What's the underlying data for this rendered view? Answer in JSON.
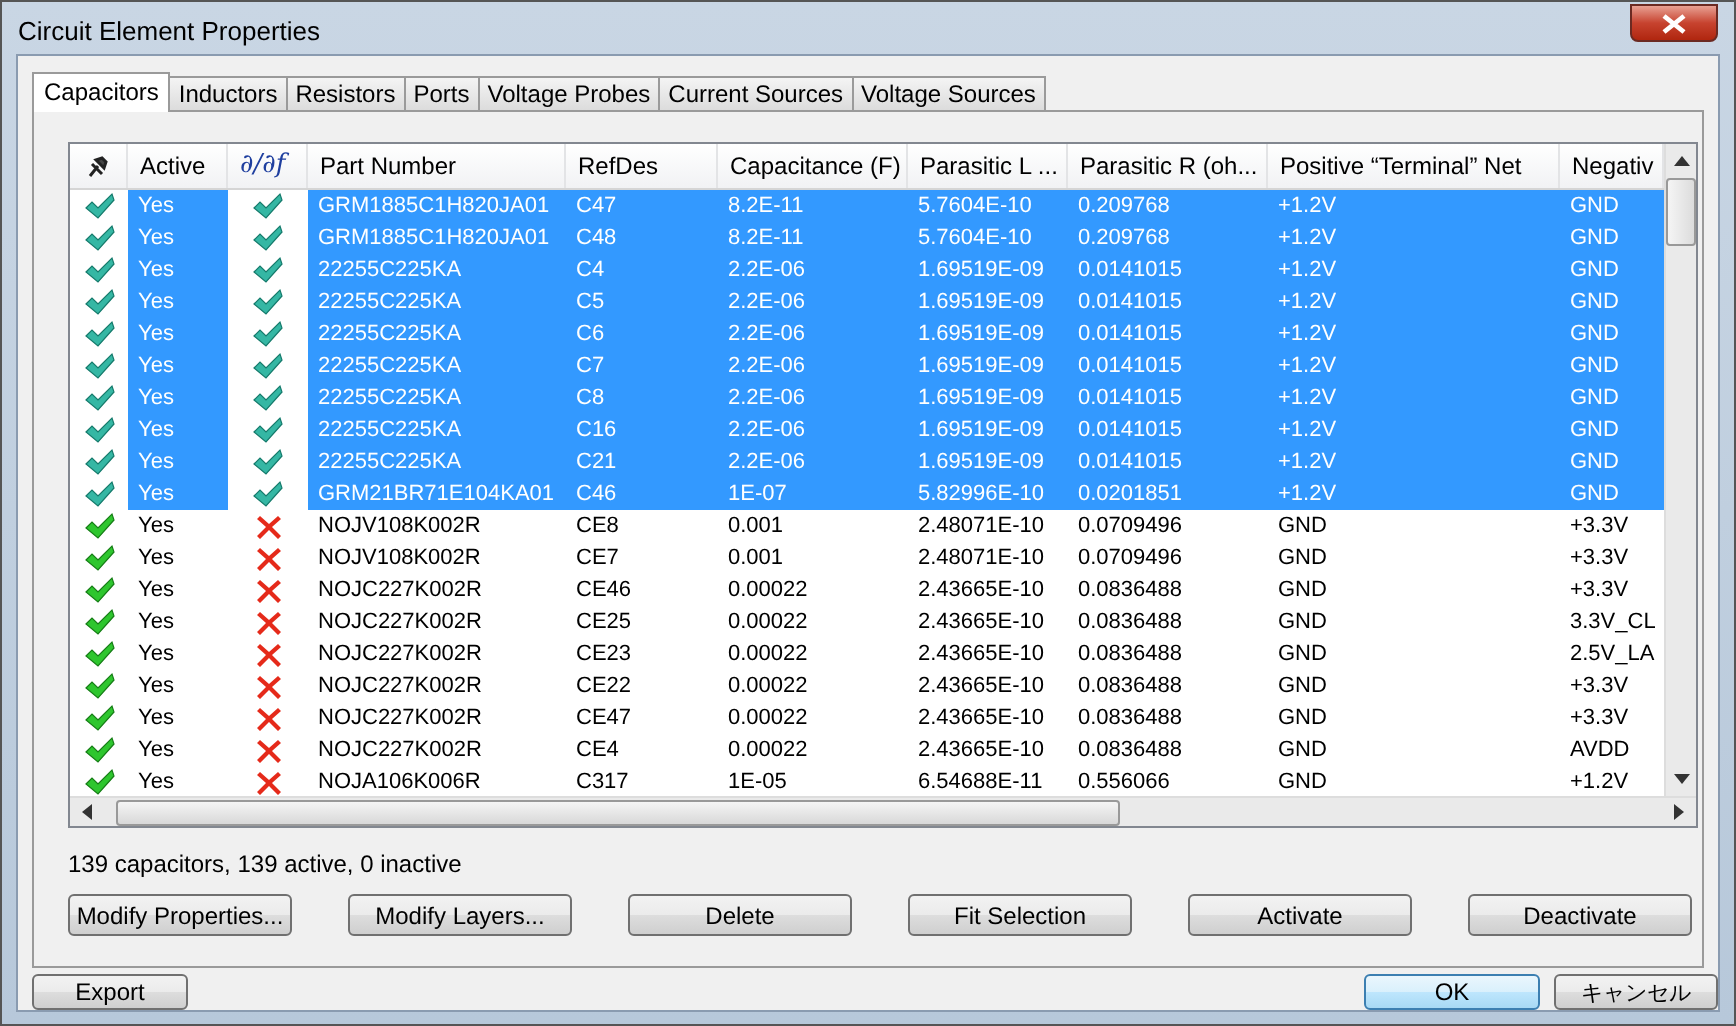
{
  "window": {
    "title": "Circuit Element Properties"
  },
  "tabs": [
    {
      "label": "Capacitors",
      "selected": true
    },
    {
      "label": "Inductors",
      "selected": false
    },
    {
      "label": "Resistors",
      "selected": false
    },
    {
      "label": "Ports",
      "selected": false
    },
    {
      "label": "Voltage Probes",
      "selected": false
    },
    {
      "label": "Current Sources",
      "selected": false
    },
    {
      "label": "Voltage Sources",
      "selected": false
    }
  ],
  "table": {
    "columns": [
      "Active",
      "∂/∂f",
      "Part Number",
      "RefDes",
      "Capacitance (F)",
      "Parasitic L ...",
      "Parasitic R (oh...",
      "Positive “Terminal” Net",
      "Negativ"
    ],
    "rows": [
      {
        "selected": true,
        "enabled": true,
        "active": "Yes",
        "frequency_dependent": true,
        "part_number": "GRM1885C1H820JA01",
        "refdes": "C47",
        "capacitance": "8.2E-11",
        "parasitic_l": "5.7604E-10",
        "parasitic_r": "0.209768",
        "positive_net": "+1.2V",
        "column_9": "GND"
      },
      {
        "selected": true,
        "enabled": true,
        "active": "Yes",
        "frequency_dependent": true,
        "part_number": "GRM1885C1H820JA01",
        "refdes": "C48",
        "capacitance": "8.2E-11",
        "parasitic_l": "5.7604E-10",
        "parasitic_r": "0.209768",
        "positive_net": "+1.2V",
        "column_9": "GND"
      },
      {
        "selected": true,
        "enabled": true,
        "active": "Yes",
        "frequency_dependent": true,
        "part_number": "22255C225KA",
        "refdes": "C4",
        "capacitance": "2.2E-06",
        "parasitic_l": "1.69519E-09",
        "parasitic_r": "0.0141015",
        "positive_net": "+1.2V",
        "column_9": "GND"
      },
      {
        "selected": true,
        "enabled": true,
        "active": "Yes",
        "frequency_dependent": true,
        "part_number": "22255C225KA",
        "refdes": "C5",
        "capacitance": "2.2E-06",
        "parasitic_l": "1.69519E-09",
        "parasitic_r": "0.0141015",
        "positive_net": "+1.2V",
        "column_9": "GND"
      },
      {
        "selected": true,
        "enabled": true,
        "active": "Yes",
        "frequency_dependent": true,
        "part_number": "22255C225KA",
        "refdes": "C6",
        "capacitance": "2.2E-06",
        "parasitic_l": "1.69519E-09",
        "parasitic_r": "0.0141015",
        "positive_net": "+1.2V",
        "column_9": "GND"
      },
      {
        "selected": true,
        "enabled": true,
        "active": "Yes",
        "frequency_dependent": true,
        "part_number": "22255C225KA",
        "refdes": "C7",
        "capacitance": "2.2E-06",
        "parasitic_l": "1.69519E-09",
        "parasitic_r": "0.0141015",
        "positive_net": "+1.2V",
        "column_9": "GND"
      },
      {
        "selected": true,
        "enabled": true,
        "active": "Yes",
        "frequency_dependent": true,
        "part_number": "22255C225KA",
        "refdes": "C8",
        "capacitance": "2.2E-06",
        "parasitic_l": "1.69519E-09",
        "parasitic_r": "0.0141015",
        "positive_net": "+1.2V",
        "column_9": "GND"
      },
      {
        "selected": true,
        "enabled": true,
        "active": "Yes",
        "frequency_dependent": true,
        "part_number": "22255C225KA",
        "refdes": "C16",
        "capacitance": "2.2E-06",
        "parasitic_l": "1.69519E-09",
        "parasitic_r": "0.0141015",
        "positive_net": "+1.2V",
        "column_9": "GND"
      },
      {
        "selected": true,
        "enabled": true,
        "active": "Yes",
        "frequency_dependent": true,
        "part_number": "22255C225KA",
        "refdes": "C21",
        "capacitance": "2.2E-06",
        "parasitic_l": "1.69519E-09",
        "parasitic_r": "0.0141015",
        "positive_net": "+1.2V",
        "column_9": "GND"
      },
      {
        "selected": true,
        "enabled": true,
        "active": "Yes",
        "frequency_dependent": true,
        "part_number": "GRM21BR71E104KA01",
        "refdes": "C46",
        "capacitance": "1E-07",
        "parasitic_l": "5.82996E-10",
        "parasitic_r": "0.0201851",
        "positive_net": "+1.2V",
        "column_9": "GND"
      },
      {
        "selected": false,
        "enabled": true,
        "active": "Yes",
        "frequency_dependent": false,
        "part_number": "NOJV108K002R",
        "refdes": "CE8",
        "capacitance": "0.001",
        "parasitic_l": "2.48071E-10",
        "parasitic_r": "0.0709496",
        "positive_net": "GND",
        "column_9": "+3.3V"
      },
      {
        "selected": false,
        "enabled": true,
        "active": "Yes",
        "frequency_dependent": false,
        "part_number": "NOJV108K002R",
        "refdes": "CE7",
        "capacitance": "0.001",
        "parasitic_l": "2.48071E-10",
        "parasitic_r": "0.0709496",
        "positive_net": "GND",
        "column_9": "+3.3V"
      },
      {
        "selected": false,
        "enabled": true,
        "active": "Yes",
        "frequency_dependent": false,
        "part_number": "NOJC227K002R",
        "refdes": "CE46",
        "capacitance": "0.00022",
        "parasitic_l": "2.43665E-10",
        "parasitic_r": "0.0836488",
        "positive_net": "GND",
        "column_9": "+3.3V"
      },
      {
        "selected": false,
        "enabled": true,
        "active": "Yes",
        "frequency_dependent": false,
        "part_number": "NOJC227K002R",
        "refdes": "CE25",
        "capacitance": "0.00022",
        "parasitic_l": "2.43665E-10",
        "parasitic_r": "0.0836488",
        "positive_net": "GND",
        "column_9": "3.3V_CL"
      },
      {
        "selected": false,
        "enabled": true,
        "active": "Yes",
        "frequency_dependent": false,
        "part_number": "NOJC227K002R",
        "refdes": "CE23",
        "capacitance": "0.00022",
        "parasitic_l": "2.43665E-10",
        "parasitic_r": "0.0836488",
        "positive_net": "GND",
        "column_9": "2.5V_LA"
      },
      {
        "selected": false,
        "enabled": true,
        "active": "Yes",
        "frequency_dependent": false,
        "part_number": "NOJC227K002R",
        "refdes": "CE22",
        "capacitance": "0.00022",
        "parasitic_l": "2.43665E-10",
        "parasitic_r": "0.0836488",
        "positive_net": "GND",
        "column_9": "+3.3V"
      },
      {
        "selected": false,
        "enabled": true,
        "active": "Yes",
        "frequency_dependent": false,
        "part_number": "NOJC227K002R",
        "refdes": "CE47",
        "capacitance": "0.00022",
        "parasitic_l": "2.43665E-10",
        "parasitic_r": "0.0836488",
        "positive_net": "GND",
        "column_9": "+3.3V"
      },
      {
        "selected": false,
        "enabled": true,
        "active": "Yes",
        "frequency_dependent": false,
        "part_number": "NOJC227K002R",
        "refdes": "CE4",
        "capacitance": "0.00022",
        "parasitic_l": "2.43665E-10",
        "parasitic_r": "0.0836488",
        "positive_net": "GND",
        "column_9": "AVDD"
      },
      {
        "selected": false,
        "enabled": true,
        "active": "Yes",
        "frequency_dependent": false,
        "part_number": "NOJA106K006R",
        "refdes": "C317",
        "capacitance": "1E-05",
        "parasitic_l": "6.54688E-11",
        "parasitic_r": "0.556066",
        "positive_net": "GND",
        "column_9": "+1.2V"
      }
    ]
  },
  "status": "139 capacitors, 139 active, 0 inactive",
  "actions": [
    "Modify Properties...",
    "Modify Layers...",
    "Delete",
    "Fit Selection",
    "Activate",
    "Deactivate"
  ],
  "footer": {
    "export": "Export",
    "ok": "OK",
    "cancel": "キャンセル"
  }
}
